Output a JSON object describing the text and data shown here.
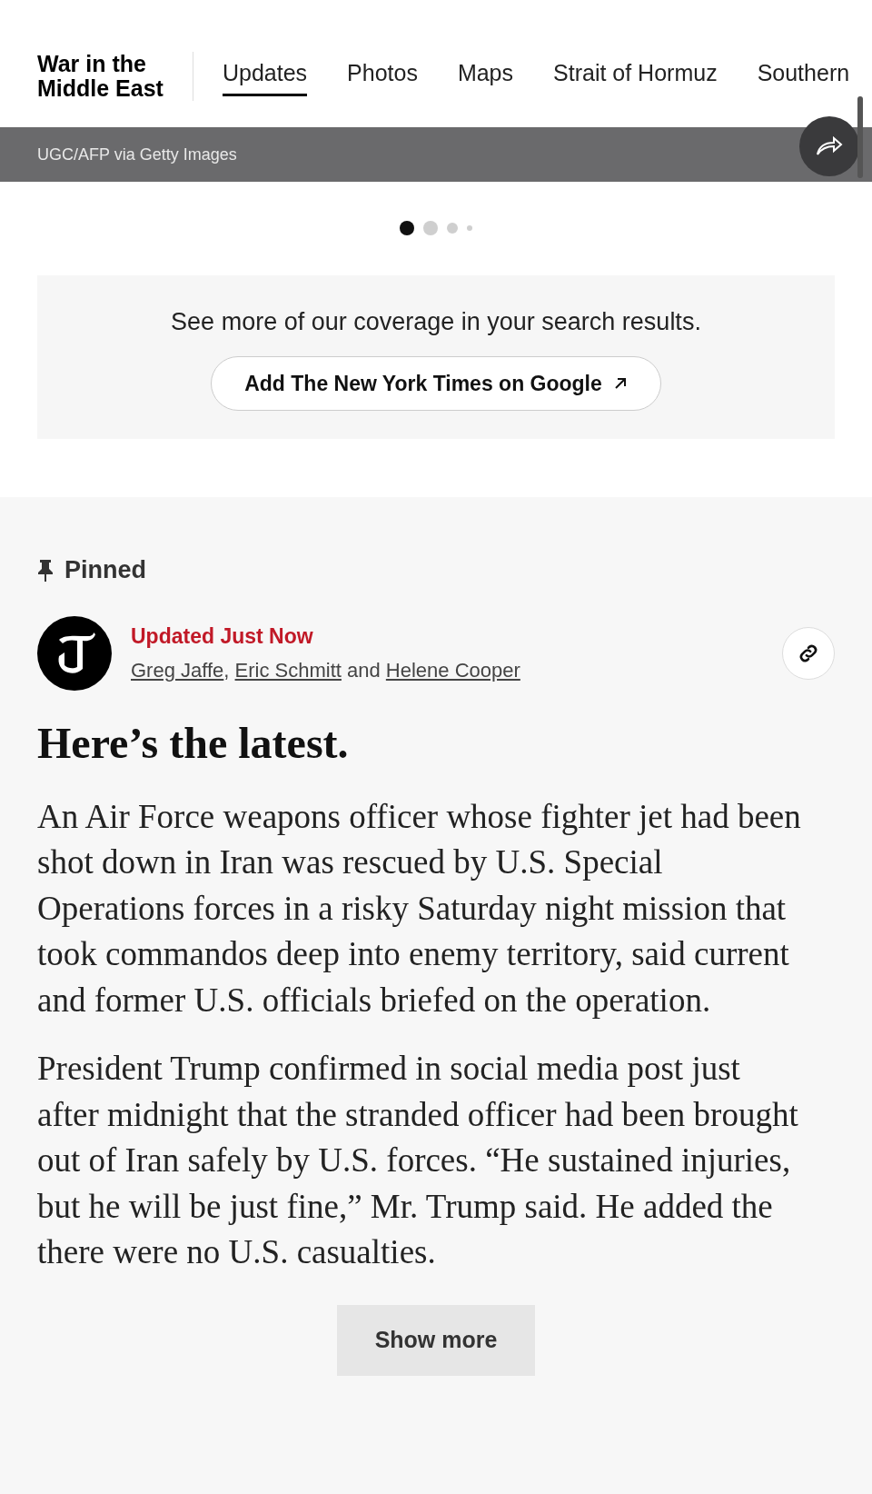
{
  "header": {
    "title_lines": [
      "War in the",
      "Middle East"
    ],
    "tabs": [
      {
        "label": "Updates",
        "selected": true
      },
      {
        "label": "Photos",
        "selected": false
      },
      {
        "label": "Maps",
        "selected": false
      },
      {
        "label": "Strait of Hormuz",
        "selected": false
      },
      {
        "label": "Southern",
        "selected": false
      }
    ]
  },
  "media": {
    "credit": "UGC/AFP via Getty Images",
    "dots": [
      {
        "selected": true
      },
      {
        "selected": false
      },
      {
        "selected": false
      },
      {
        "selected": false
      }
    ]
  },
  "promo": {
    "text": "See more of our coverage in your search results.",
    "button": "Add The New York Times on Google"
  },
  "post": {
    "pinned_label": "Pinned",
    "status": "Updated Just Now",
    "authors": [
      "Greg Jaffe",
      "Eric Schmitt",
      "Helene Cooper"
    ],
    "separators": [
      ", ",
      " and "
    ],
    "headline": "Here’s the latest.",
    "paragraphs": [
      "An Air Force weapons officer whose fighter jet had been shot down in Iran was rescued by U.S. Special Operations forces in a risky Saturday night mission that took commandos deep into enemy territory, said current and former U.S. officials briefed on the operation.",
      "President Trump confirmed in social media post just after midnight that the stranded officer had been brought out of Iran safely by U.S. forces. “He sustained injuries, but he will be just fine,” Mr. Trump said. He added the there were no U.S. casualties."
    ],
    "show_more": "Show more"
  }
}
